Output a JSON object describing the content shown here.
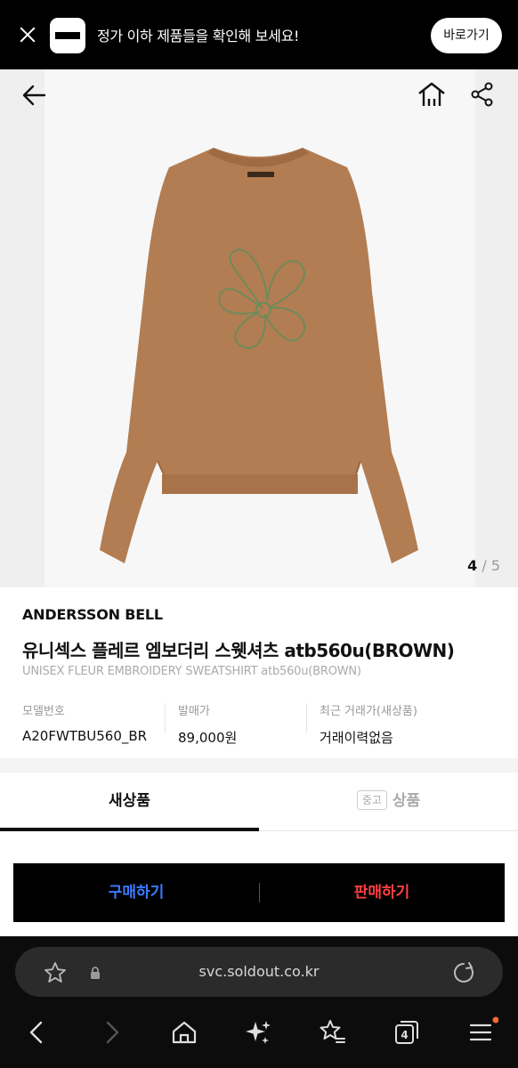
{
  "promo": {
    "message": "정가 이하 제품들을 확인해 보세요!",
    "cta": "바로가기"
  },
  "gallery": {
    "current": "4",
    "separator": " / ",
    "total": "5"
  },
  "product": {
    "brand": "ANDERSSON BELL",
    "name_ko": "유니섹스 플레르 엠보더리 스웻셔츠 atb560u(BROWN)",
    "name_en": "UNISEX FLEUR EMBROIDERY SWEATSHIRT atb560u(BROWN)",
    "model_label": "모델번호",
    "model_value": "A20FWTBU560_BR",
    "release_price_label": "발매가",
    "release_price_value": "89,000원",
    "recent_trade_label": "최근 거래가(새상품)",
    "recent_trade_value": "거래이력없음"
  },
  "tabs": {
    "new_label": "새상품",
    "used_chip": "중고",
    "used_label": "상품"
  },
  "actions": {
    "buy": "구매하기",
    "sell": "판매하기"
  },
  "browser": {
    "url": "svc.soldout.co.kr",
    "tab_count": "4"
  },
  "colors": {
    "buy": "#3a7bff",
    "sell": "#ff4040",
    "sweatshirt": "#b27d52"
  }
}
